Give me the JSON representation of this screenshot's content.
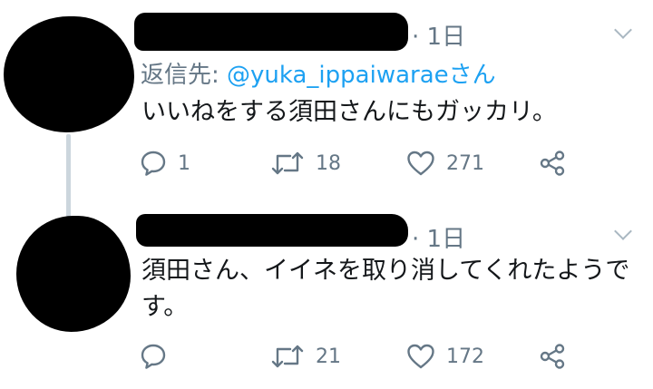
{
  "tweets": [
    {
      "time": "· 1日",
      "reply_prefix": "返信先:",
      "reply_handle": "@yuka_ippaiwarae",
      "reply_suffix": "さん",
      "text": "いいねをする須田さんにもガッカリ。",
      "replies": "1",
      "retweets": "18",
      "likes": "271"
    },
    {
      "time": "· 1日",
      "text": "須田さん、イイネを取り消してくれたようです。",
      "replies": "",
      "retweets": "21",
      "likes": "172"
    }
  ],
  "icons": {
    "reply": "reply-icon",
    "retweet": "retweet-icon",
    "like": "heart-icon",
    "share": "share-icon",
    "menu": "chevron-down-icon"
  },
  "colors": {
    "secondary_text": "#657786",
    "link": "#1da1f2",
    "thread_line": "#ccd6dd"
  }
}
